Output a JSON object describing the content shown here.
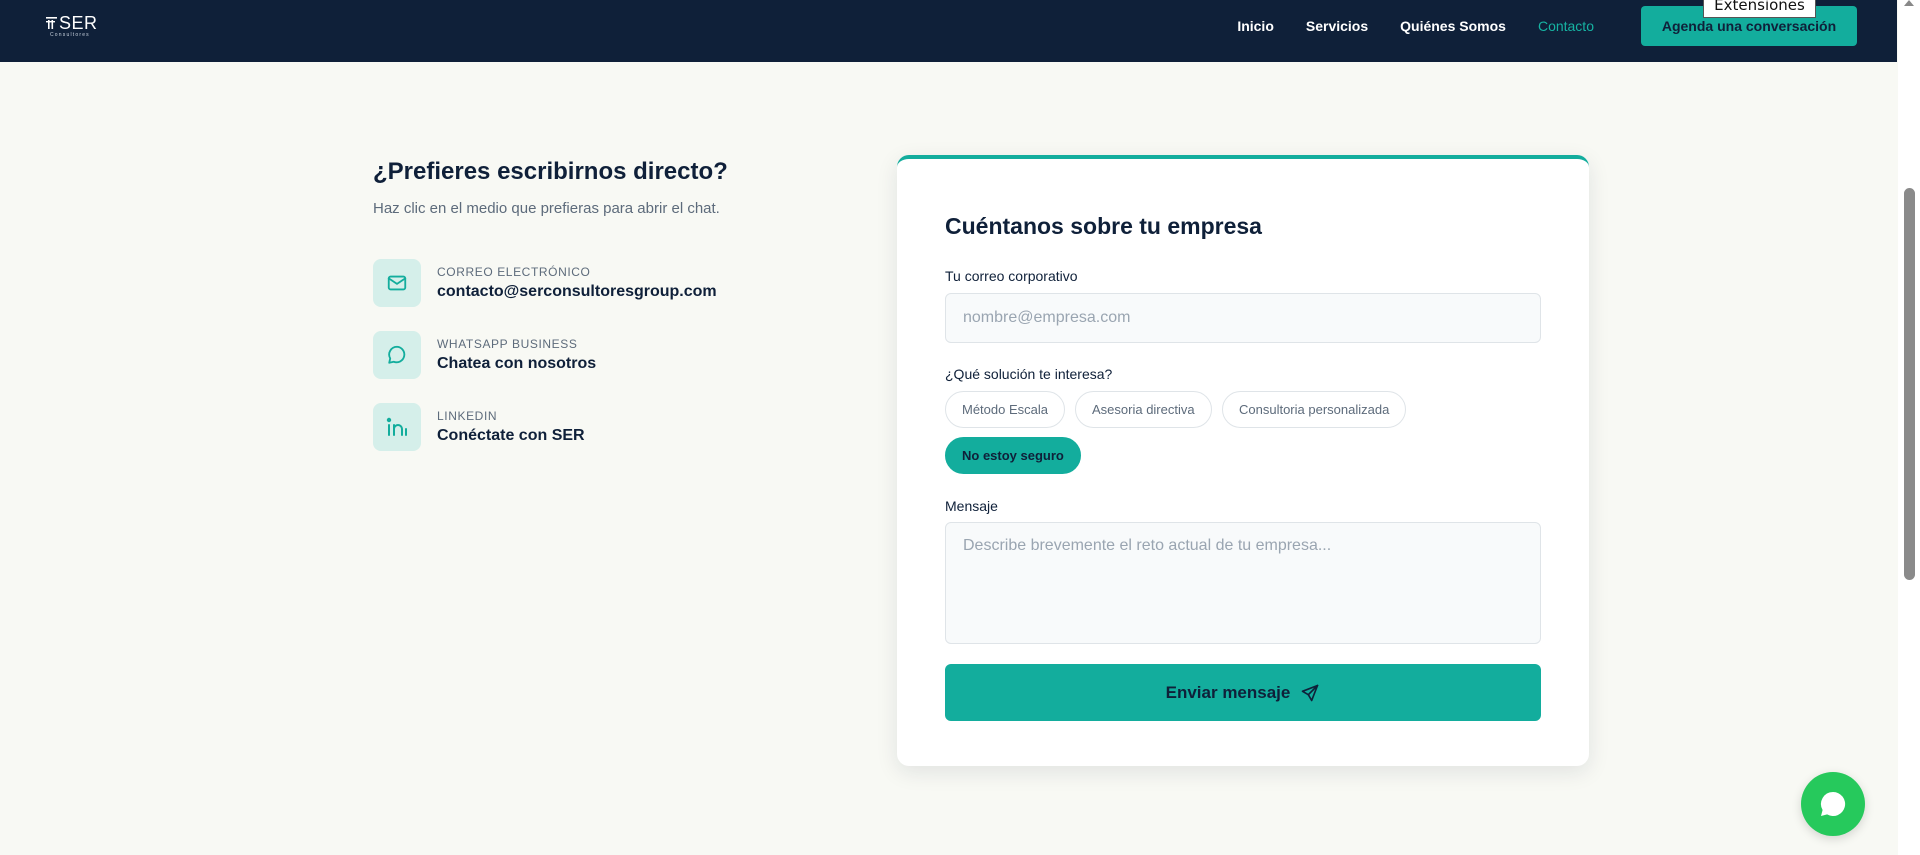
{
  "nav": {
    "logo_text": "SER",
    "logo_sub": "Consultores",
    "links": [
      "Inicio",
      "Servicios",
      "Quiénes Somos",
      "Contacto"
    ],
    "active_link": "Contacto",
    "cta_label": "Agenda una conversación"
  },
  "tooltip": {
    "text": "Extensiones"
  },
  "left": {
    "title": "¿Prefieres escribirnos directo?",
    "subtitle": "Haz clic en el medio que prefieras para abrir el chat.",
    "channels": [
      {
        "label": "CORREO ELECTRÓNICO",
        "value": "contacto@serconsultoresgroup.com",
        "icon": "mail-icon"
      },
      {
        "label": "WHATSAPP BUSINESS",
        "value": "Chatea con nosotros",
        "icon": "chat-bubble-icon"
      },
      {
        "label": "LINKEDIN",
        "value": "Conéctate con SER",
        "icon": "linkedin-icon"
      }
    ]
  },
  "form": {
    "title": "Cuéntanos sobre tu empresa",
    "email_label": "Tu correo corporativo",
    "email_placeholder": "nombre@empresa.com",
    "email_value": "",
    "solution_label": "¿Qué solución te interesa?",
    "solutions": [
      "Método Escala",
      "Asesoria directiva",
      "Consultoria personalizada",
      "No estoy seguro"
    ],
    "selected_solution": "No estoy seguro",
    "message_label": "Mensaje",
    "message_placeholder": "Describe brevemente el reto actual de tu empresa...",
    "message_value": "",
    "submit_label": "Enviar mensaje"
  },
  "colors": {
    "navy": "#0f2039",
    "teal": "#13ad9d",
    "background": "#f8f9f4",
    "whatsapp_green": "#26c95c"
  }
}
